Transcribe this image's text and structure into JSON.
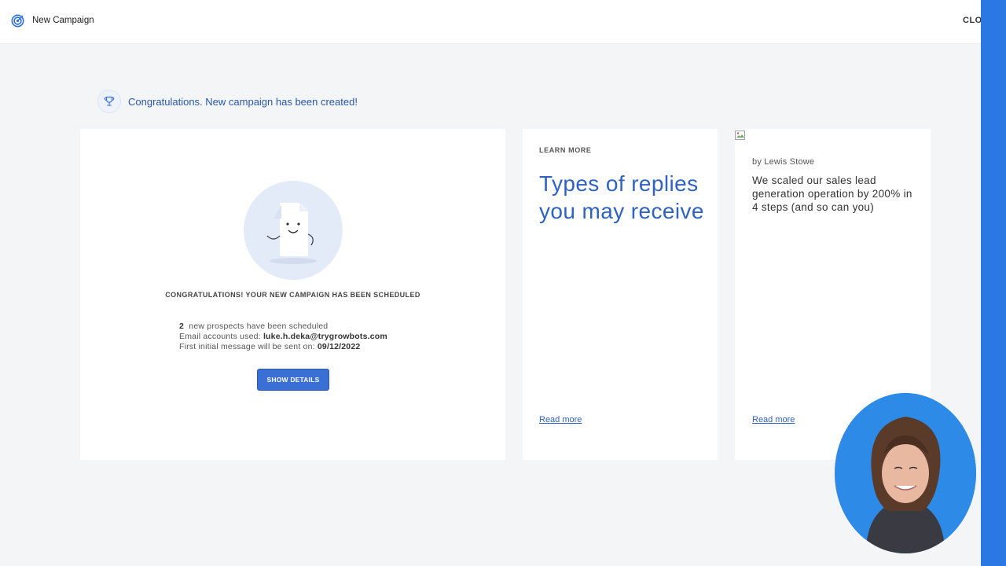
{
  "header": {
    "title": "New Campaign",
    "close_label": "CLOSE"
  },
  "banner": {
    "text": "Congratulations. New campaign has been created!"
  },
  "main_card": {
    "heading": "CONGRATULATIONS! YOUR NEW CAMPAIGN HAS BEEN SCHEDULED",
    "prospects_count": "2",
    "prospects_text": "new prospects have been scheduled",
    "email_label": "Email accounts used:",
    "email_value": "luke.h.deka@trygrowbots.com",
    "send_label": "First initial message will be sent on:",
    "send_date": "09/12/2022",
    "button_label": "SHOW DETAILS"
  },
  "learn_card": {
    "label": "LEARN MORE",
    "title": "Types of replies you may receive",
    "read_more": "Read more"
  },
  "blog_card": {
    "author": "by Lewis Stowe",
    "title": "We scaled our sales lead generation operation by 200% in 4 steps (and so can you)",
    "read_more": "Read more"
  },
  "colors": {
    "accent": "#2e62c3",
    "button": "#3a6fd6",
    "side_strip": "#2b78e4",
    "background": "#f4f5f7"
  },
  "icons": [
    "target-logo-icon",
    "trophy-icon",
    "broken-image-icon",
    "document-character-illustration"
  ]
}
